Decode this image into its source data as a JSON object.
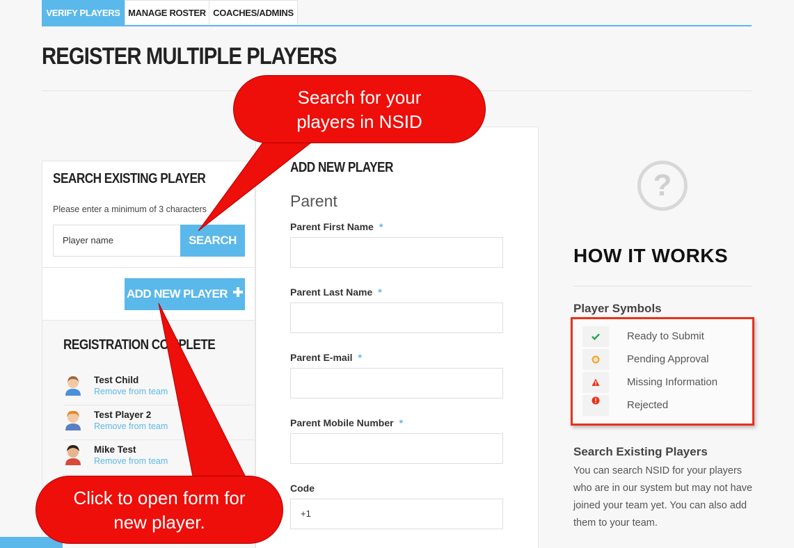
{
  "tabs": [
    {
      "label": "VERIFY PLAYERS",
      "active": true
    },
    {
      "label": "MANAGE ROSTER",
      "active": false
    },
    {
      "label": "COACHES/ADMINS",
      "active": false
    }
  ],
  "page_title": "REGISTER MULTIPLE PLAYERS",
  "search_panel": {
    "title": "SEARCH EXISTING PLAYER",
    "hint": "Please enter a minimum of 3 characters",
    "input_value": "Player name",
    "search_label": "SEARCH",
    "add_label": "ADD NEW PLAYER"
  },
  "registration": {
    "title": "REGISTRATION COMPLETE",
    "players": [
      {
        "name": "Test Child",
        "action": "Remove from team"
      },
      {
        "name": "Test Player 2",
        "action": "Remove from team"
      },
      {
        "name": "Mike Test",
        "action": "Remove from team"
      }
    ]
  },
  "form": {
    "title": "ADD NEW PLAYER",
    "section": "Parent",
    "fields": [
      {
        "label": "Parent First Name",
        "required": "*",
        "value": ""
      },
      {
        "label": "Parent Last Name",
        "required": "*",
        "value": ""
      },
      {
        "label": "Parent E-mail",
        "required": "*",
        "value": ""
      },
      {
        "label": "Parent Mobile Number",
        "required": "*",
        "value": ""
      },
      {
        "label": "Code",
        "required": "",
        "value": "+1"
      }
    ]
  },
  "how_it_works": {
    "title": "HOW IT WORKS",
    "symbols_title": "Player Symbols",
    "symbols": [
      {
        "label": "Ready to Submit",
        "icon": "check-icon",
        "color": "#2aa84a"
      },
      {
        "label": "Pending Approval",
        "icon": "pending-circle-icon",
        "color": "#f0a22e"
      },
      {
        "label": "Missing Information",
        "icon": "warning-triangle-icon",
        "color": "#e8311b"
      },
      {
        "label": "Rejected",
        "icon": "rejected-circle-icon",
        "color": "#e8311b"
      }
    ],
    "search_title": "Search Existing Players",
    "search_body": "You can search NSID for your players who are in our system but may not have joined your team yet. You can also add them to your team."
  },
  "callouts": {
    "top": "Search for your players in NSID",
    "bottom": "Click to open form for new player."
  },
  "colors": {
    "accent": "#5bb8ea",
    "callout": "#ee0e0a",
    "highlight_border": "#e8311b"
  }
}
